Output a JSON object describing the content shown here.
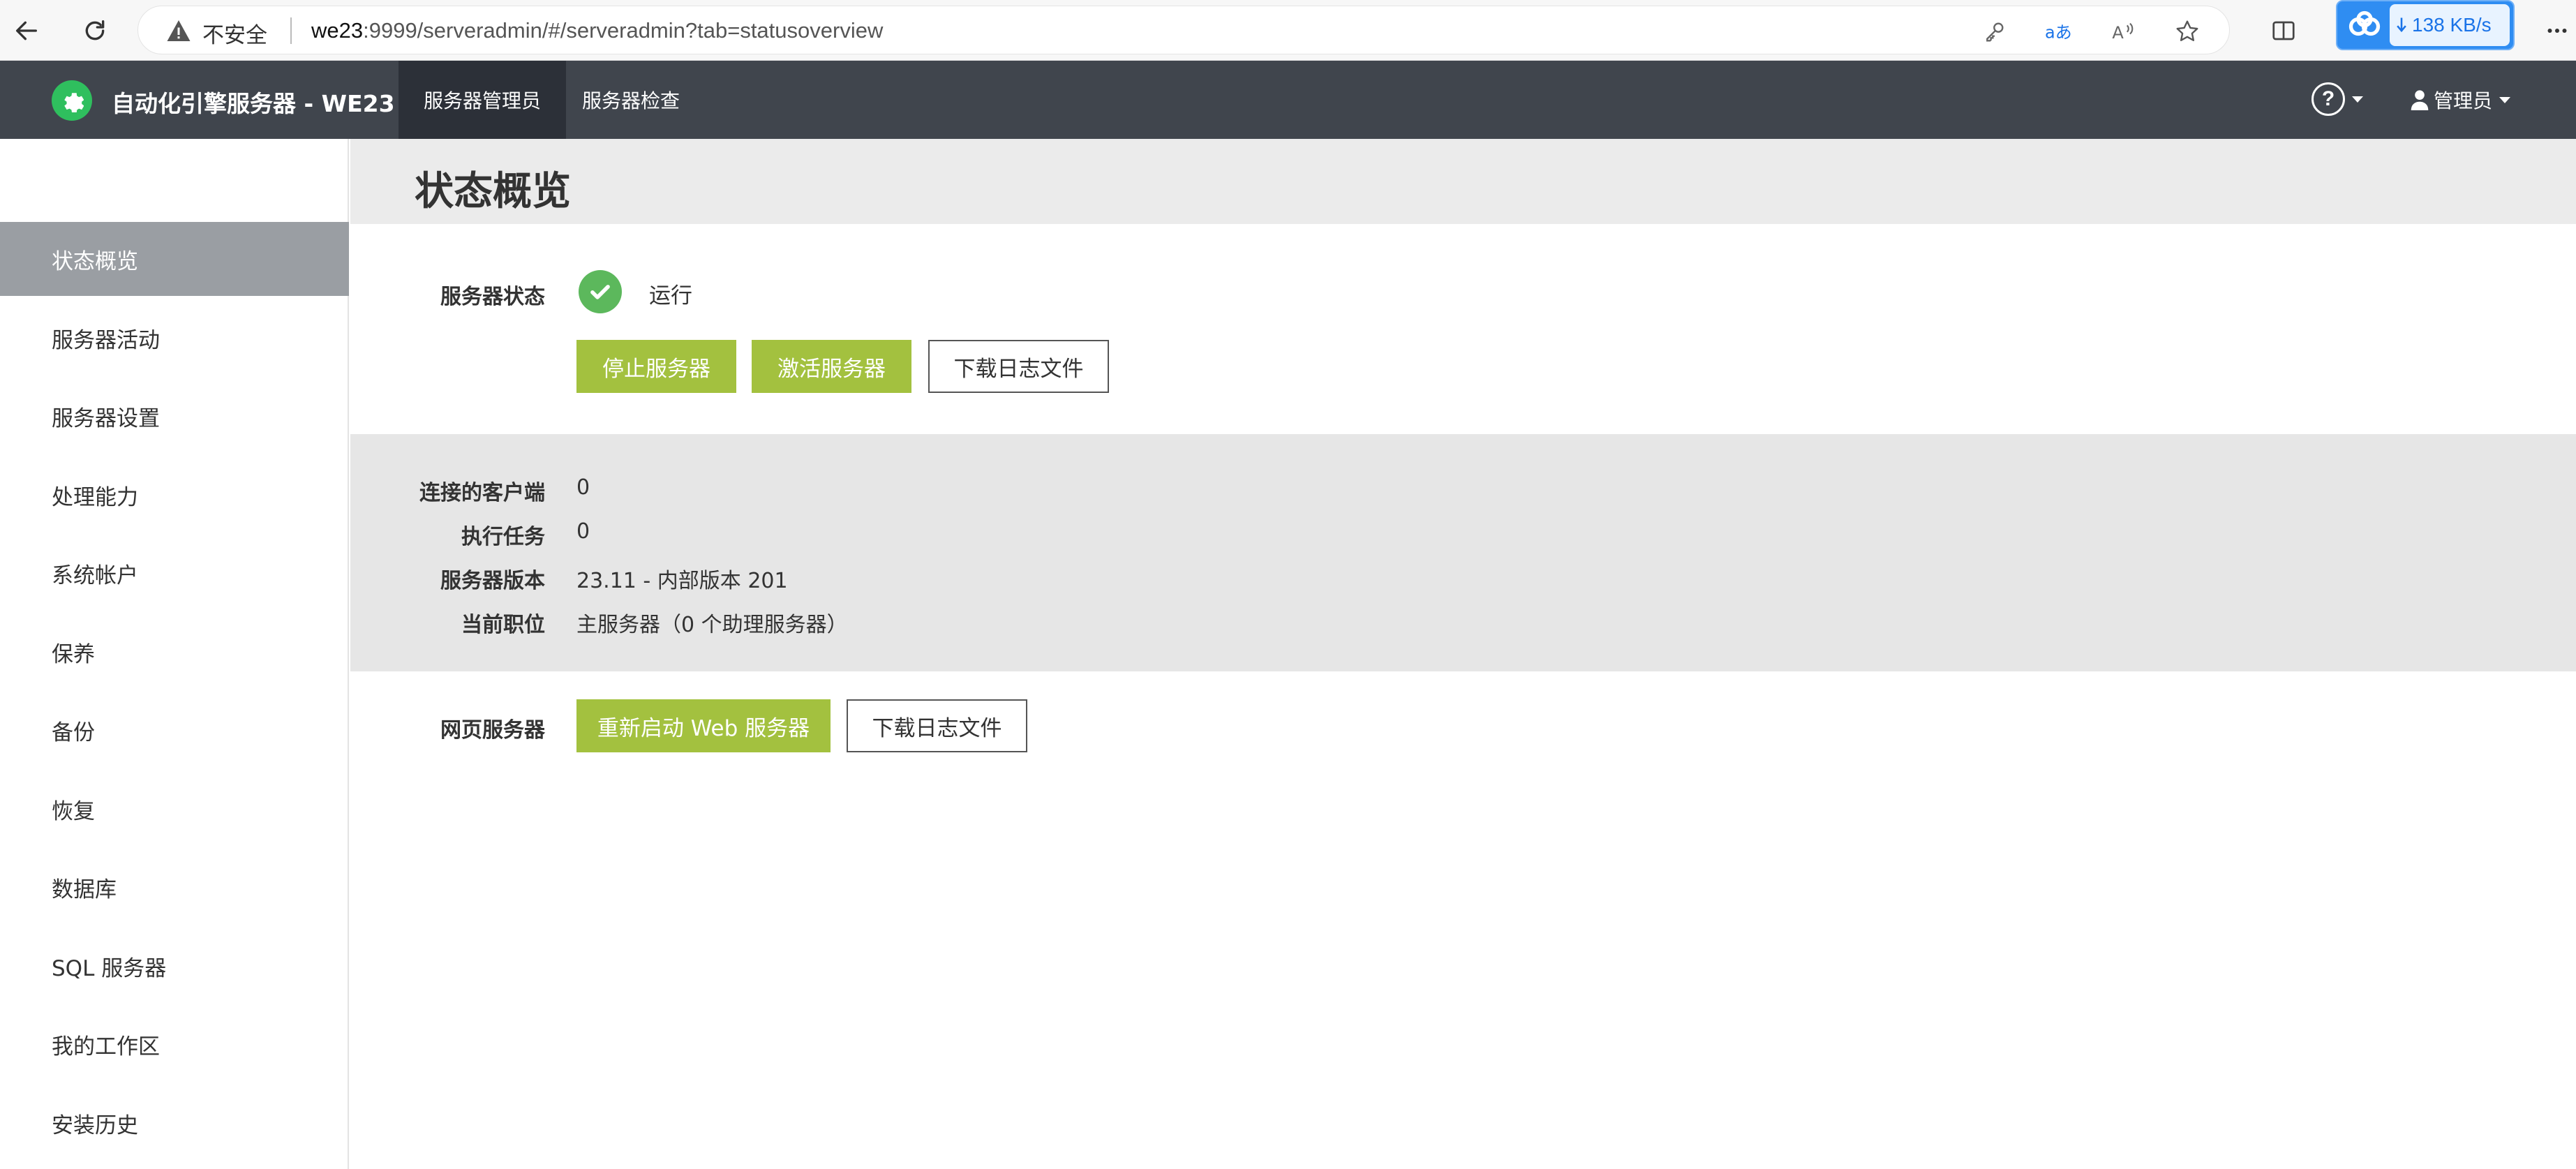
{
  "browser": {
    "security_label": "不安全",
    "url_host": "we23",
    "url_rest": ":9999/serveradmin/#/serveradmin?tab=statusoverview",
    "download_speed": "138 KB/s",
    "icons": [
      "back-icon",
      "refresh-icon",
      "warning-icon",
      "key-icon",
      "translate-icon",
      "read-aloud-icon",
      "favorite-star-icon",
      "split-screen-icon",
      "cloud-download-icon",
      "more-icon"
    ]
  },
  "header": {
    "app_title": "自动化引擎服务器 - WE23",
    "tabs": [
      {
        "label": "服务器管理员",
        "active": true
      },
      {
        "label": "服务器检查",
        "active": false
      }
    ],
    "user_label": "管理员",
    "help_glyph": "?"
  },
  "sidebar": {
    "items": [
      {
        "label": "状态概览",
        "active": true
      },
      {
        "label": "服务器活动",
        "active": false
      },
      {
        "label": "服务器设置",
        "active": false
      },
      {
        "label": "处理能力",
        "active": false
      },
      {
        "label": "系统帐户",
        "active": false
      },
      {
        "label": "保养",
        "active": false
      },
      {
        "label": "备份",
        "active": false
      },
      {
        "label": "恢复",
        "active": false
      },
      {
        "label": "数据库",
        "active": false
      },
      {
        "label": "SQL 服务器",
        "active": false
      },
      {
        "label": "我的工作区",
        "active": false
      },
      {
        "label": "安装历史",
        "active": false
      }
    ]
  },
  "main": {
    "page_title": "状态概览",
    "server_status": {
      "label": "服务器状态",
      "value": "运行",
      "buttons": {
        "stop": "停止服务器",
        "activate": "激活服务器",
        "download_log": "下载日志文件"
      }
    },
    "info": [
      {
        "label": "连接的客户端",
        "value": "0"
      },
      {
        "label": "执行任务",
        "value": "0"
      },
      {
        "label": "服务器版本",
        "value": "23.11 - 内部版本 201"
      },
      {
        "label": "当前职位",
        "value": "主服务器（0 个助理服务器）"
      }
    ],
    "web_server": {
      "label": "网页服务器",
      "buttons": {
        "restart": "重新启动 Web 服务器",
        "download_log": "下载日志文件"
      }
    }
  },
  "colors": {
    "header_bg": "#40454d",
    "active_tab_bg": "#2c3038",
    "sidebar_active_bg": "#9a9ea3",
    "accent_green": "#a3c13f",
    "status_ok": "#5cb85c",
    "logo_green": "#2fbf5e",
    "band_gray": "#e6e6e6"
  }
}
